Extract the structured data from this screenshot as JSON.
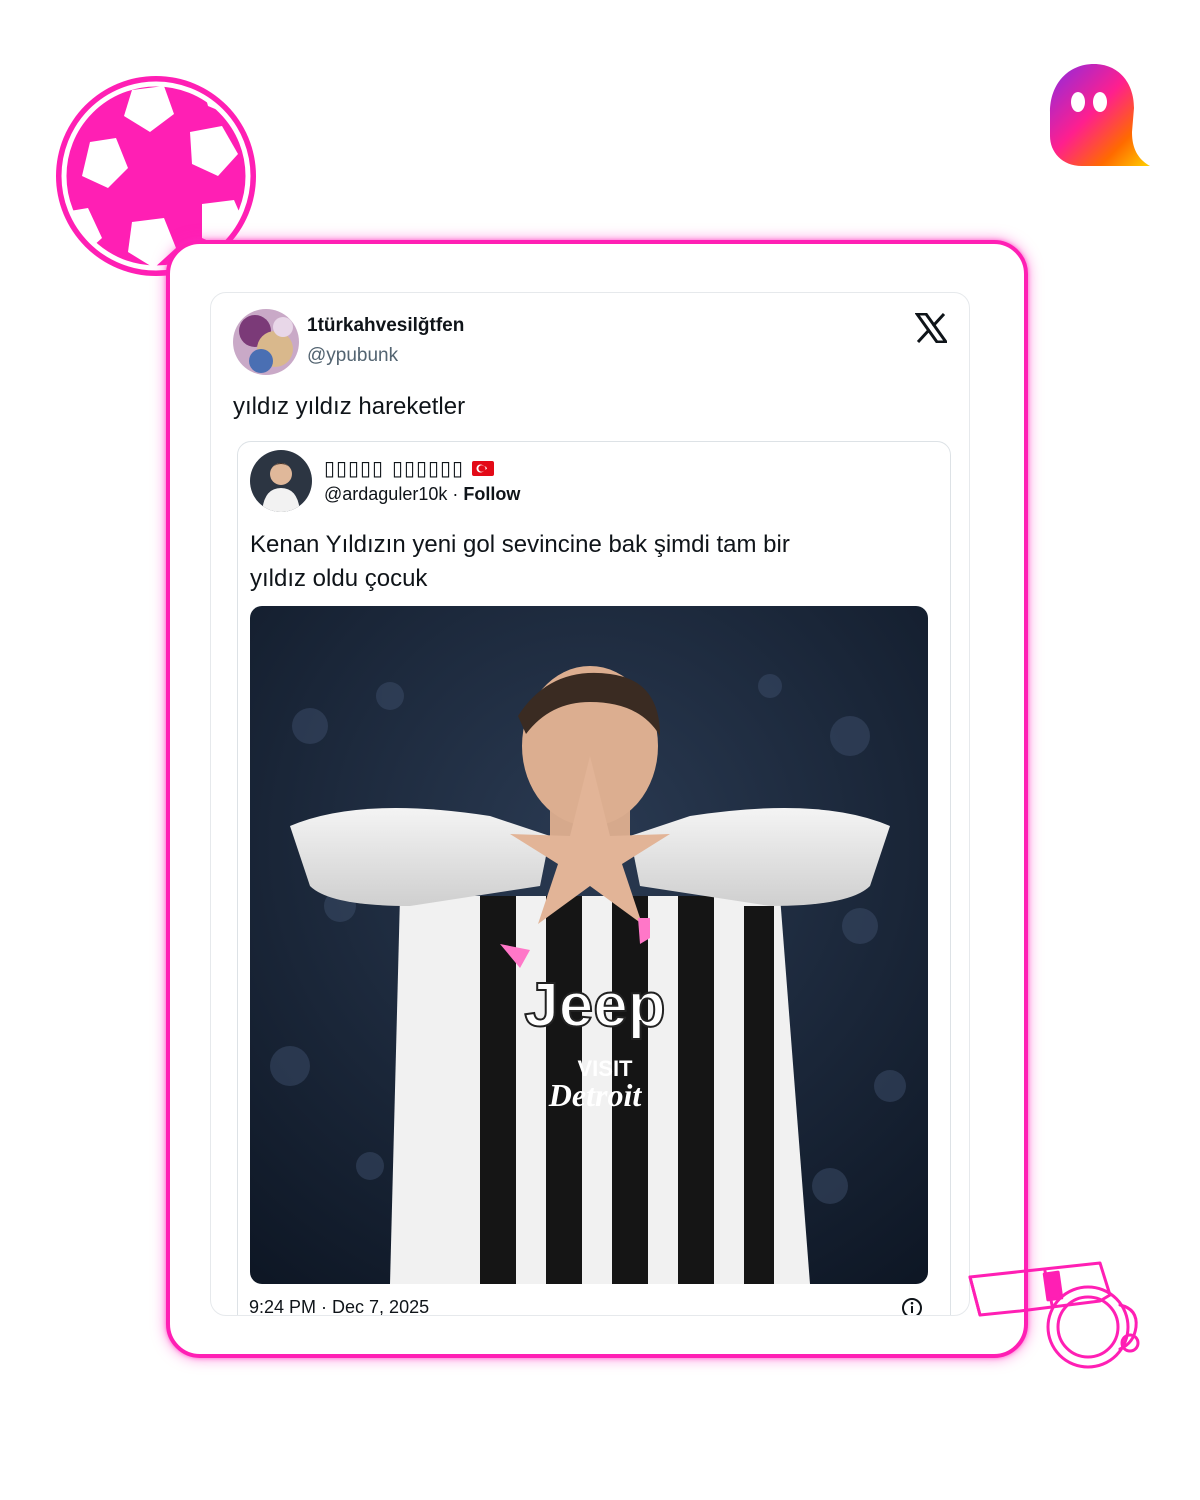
{
  "decor": {
    "ball_icon": "soccer-ball-icon",
    "brand_icon": "ghost-logo-icon",
    "whistle_icon": "whistle-icon",
    "accent_color": "#ff1fb4"
  },
  "tweet": {
    "author_name": "1türkahvesilğtfen",
    "author_handle": "@ypubunk",
    "text": "yıldız yıldız hareketler",
    "platform_icon": "x-logo-icon",
    "timestamp": "9:24 PM · Dec 7, 2025",
    "info_icon": "info-icon"
  },
  "quoted": {
    "display_name": "▯▯▯▯▯ ▯▯▯▯▯▯",
    "flag_icon": "turkey-flag-icon",
    "handle": "@ardaguler10k",
    "separator": " · ",
    "follow_label": "Follow",
    "text_line1": "Kenan Yıldızın yeni gol sevincine bak  şimdi tam bir",
    "text_line2": "yıldız oldu çocuk",
    "photo_sponsor": "Jeep",
    "photo_sponsor2": "VISIT",
    "photo_sponsor3": "Detroit"
  }
}
